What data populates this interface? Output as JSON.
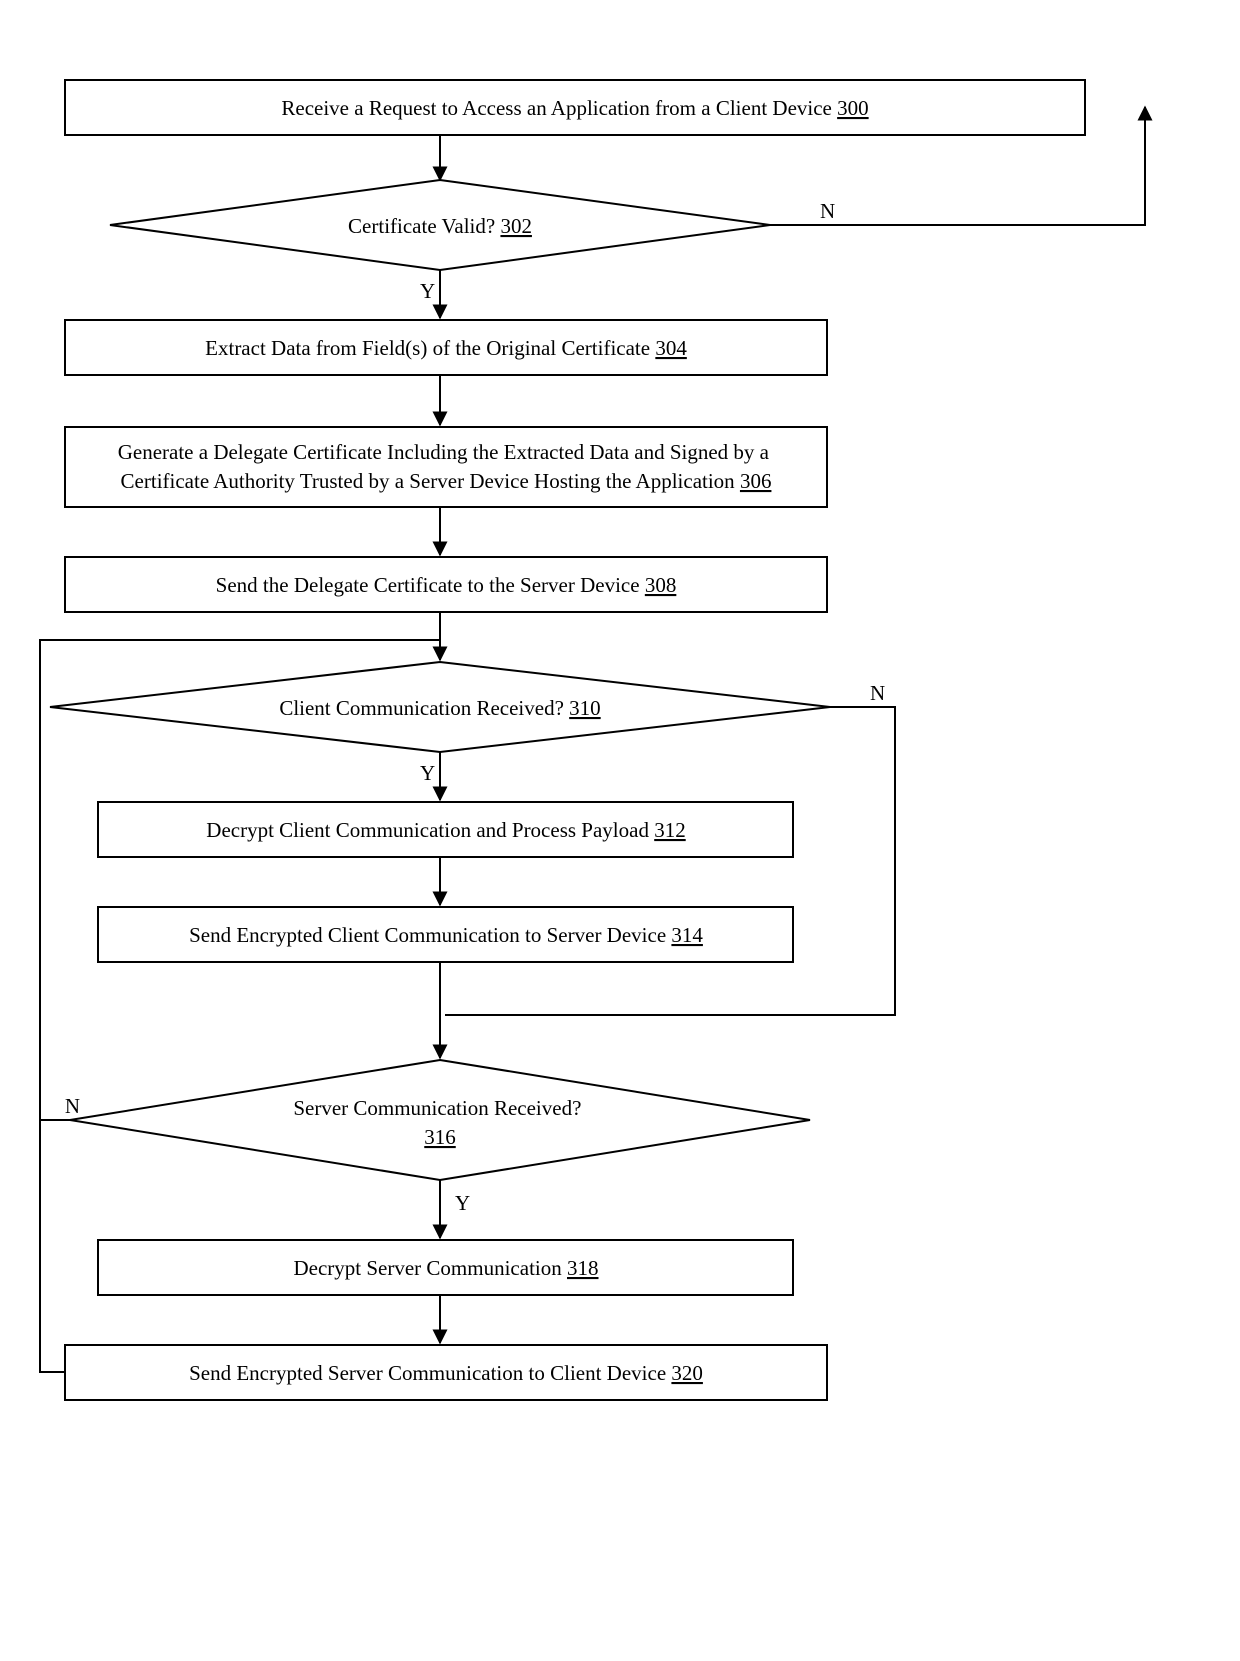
{
  "nodes": {
    "n300": {
      "text": "Receive a Request to Access an Application from a Client Device",
      "ref": "300"
    },
    "n302": {
      "text": "Certificate Valid?",
      "ref": "302"
    },
    "n304": {
      "text": "Extract Data from Field(s) of the Original Certificate",
      "ref": "304"
    },
    "n306": {
      "text": "Generate a Delegate Certificate Including the Extracted Data and Signed by a Certificate Authority Trusted by a Server Device Hosting the Application",
      "ref": "306"
    },
    "n308": {
      "text": "Send the Delegate Certificate to the Server Device",
      "ref": "308"
    },
    "n310": {
      "text": "Client Communication Received?",
      "ref": "310"
    },
    "n312": {
      "text": "Decrypt Client Communication and Process Payload",
      "ref": "312"
    },
    "n314": {
      "text": "Send Encrypted Client Communication to Server Device",
      "ref": "314"
    },
    "n316": {
      "text": "Server Communication Received?",
      "ref": "316"
    },
    "n318": {
      "text": "Decrypt Server Communication",
      "ref": "318"
    },
    "n320": {
      "text": "Send Encrypted Server Communication to Client Device",
      "ref": "320"
    }
  },
  "labels": {
    "yes": "Y",
    "no": "N"
  }
}
